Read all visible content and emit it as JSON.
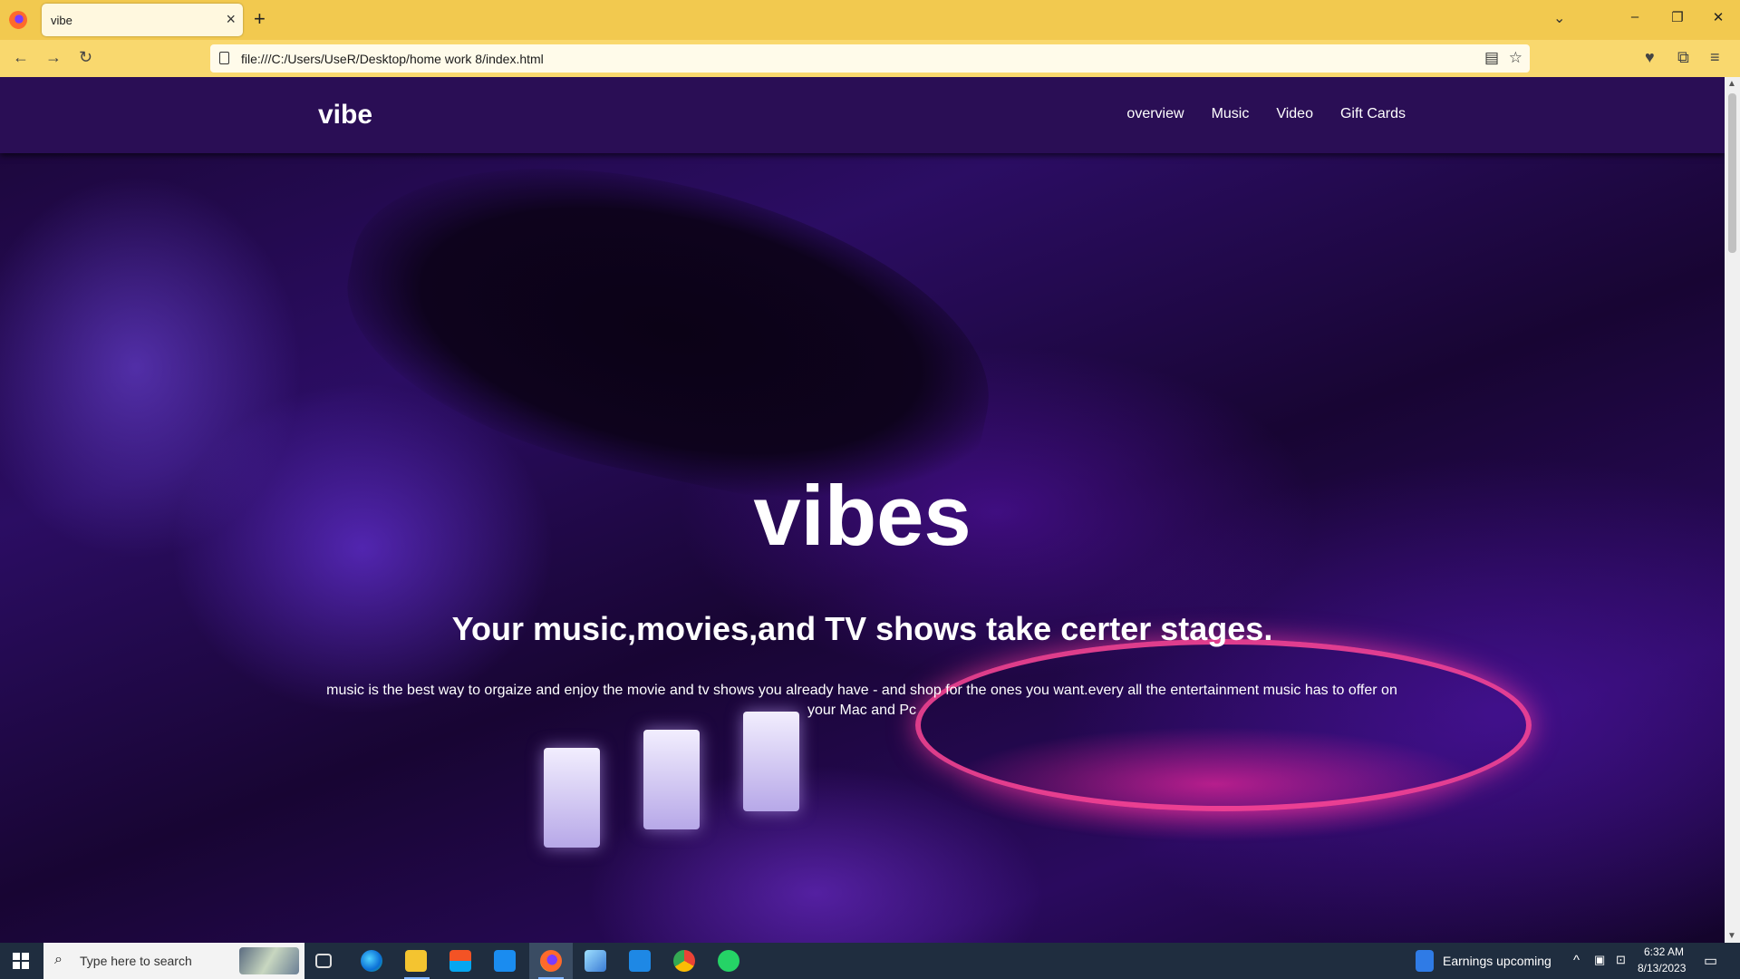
{
  "browser": {
    "tab_title": "vibe",
    "tab_close": "×",
    "new_tab": "+",
    "list_all_tabs": "⌄",
    "minimize": "–",
    "restore": "❐",
    "close": "✕",
    "back": "←",
    "forward": "→",
    "reload": "↻",
    "url": "file:///C:/Users/UseR/Desktop/home work 8/index.html",
    "reader_view": "▤",
    "bookmark": "☆",
    "pocket": "♥",
    "extensions": "⧉",
    "menu": "≡"
  },
  "site": {
    "brand": "vibe",
    "nav": [
      "overview",
      "Music",
      "Video",
      "Gift Cards"
    ],
    "hero_title": "vibes",
    "hero_subtitle": "Your music,movies,and TV shows take certer stages.",
    "hero_text": "music is the best way to orgaize and enjoy the movie and tv shows you already have - and shop for the ones you want.every all the entertainment music has to offer on your Mac and Pc"
  },
  "taskbar": {
    "search_placeholder": "Type here to search",
    "search_icon": "⌕",
    "news_label": "Earnings upcoming",
    "tray_chevron": "^",
    "time": "6:32 AM",
    "date": "8/13/2023",
    "notification_icon": "▭",
    "apps": [
      "task-view",
      "edge",
      "file-explorer",
      "microsoft-store",
      "mail",
      "firefox",
      "notepad",
      "vscode",
      "chrome",
      "whatsapp"
    ]
  },
  "colors": {
    "tabstrip": "#f2c94f",
    "site_header": "#2a0e55",
    "taskbar": "#1f2d3f"
  }
}
